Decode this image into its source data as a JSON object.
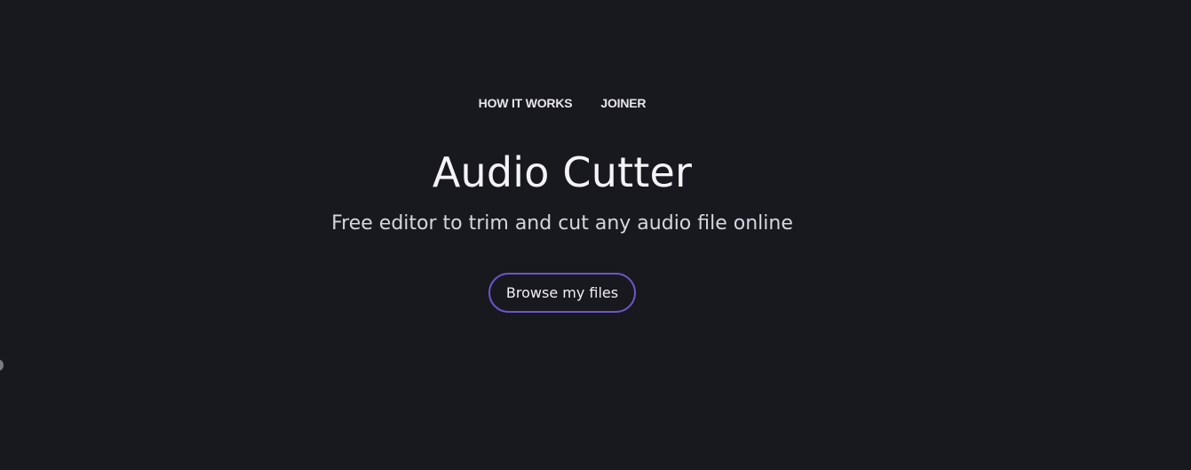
{
  "nav": {
    "items": [
      {
        "label": "HOW IT WORKS"
      },
      {
        "label": "JOINER"
      }
    ]
  },
  "hero": {
    "title": "Audio Cutter",
    "subtitle": "Free editor to trim and cut any audio file online",
    "browse_label": "Browse my files"
  },
  "colors": {
    "background": "#18181f",
    "button_border": "#6a56c8"
  }
}
